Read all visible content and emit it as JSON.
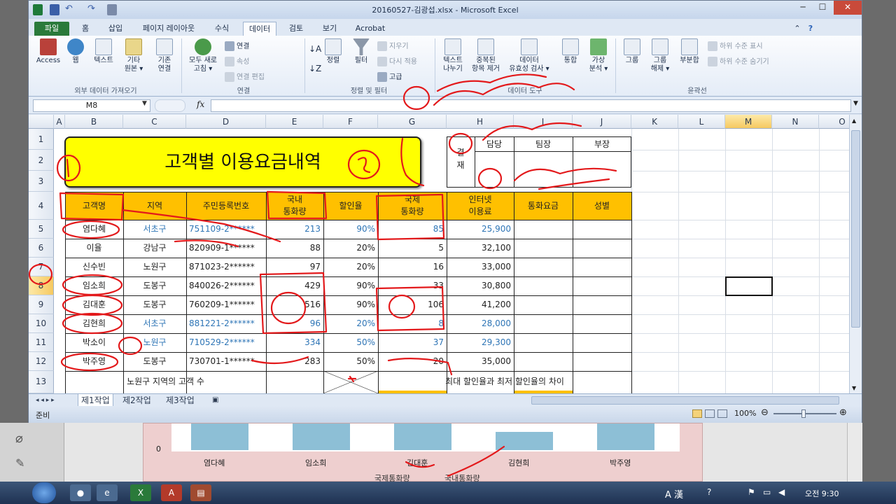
{
  "window": {
    "title": "20160527-김광섭.xlsx - Microsoft Excel",
    "minimize": "─",
    "maximize": "☐",
    "close": "✕"
  },
  "tabs": [
    "파일",
    "홈",
    "삽입",
    "페이지 레이아웃",
    "수식",
    "데이터",
    "검토",
    "보기",
    "Acrobat"
  ],
  "ribbon": {
    "external": {
      "access": "Access",
      "web": "웹",
      "text": "텍스트",
      "other1": "기타",
      "other2": "원본 ▾",
      "existing1": "기존",
      "existing2": "연결",
      "label": "외부 데이터 가져오기"
    },
    "connections": {
      "refresh1": "모두 새로",
      "refresh2": "고침 ▾",
      "connect": "연결",
      "props": "속성",
      "edit": "연결 편집",
      "label": "연결"
    },
    "sort": {
      "sort": "정렬",
      "filter": "필터",
      "clear": "지우기",
      "reapply": "다시 적용",
      "advanced": "고급",
      "label": "정렬 및 필터"
    },
    "tools": {
      "t2c1": "텍스트",
      "t2c2": "나누기",
      "dup1": "중복된",
      "dup2": "항목 제거",
      "valid1": "데이터",
      "valid2": "유효성 검사 ▾",
      "cons": "통합",
      "whatif1": "가상",
      "whatif2": "분석 ▾",
      "label": "데이터 도구"
    },
    "outline": {
      "group": "그룹",
      "ungroup1": "그룹",
      "ungroup2": "해제 ▾",
      "subtotal": "부분합",
      "show": "하위 수준 표시",
      "hide": "하위 수준 숨기기",
      "label": "윤곽선"
    }
  },
  "formula": {
    "name_box": "M8",
    "fx": "fx"
  },
  "columns": [
    "A",
    "B",
    "C",
    "D",
    "E",
    "F",
    "G",
    "H",
    "I",
    "J",
    "K",
    "L",
    "M",
    "N",
    "O"
  ],
  "rows": [
    "1",
    "2",
    "3",
    "4",
    "5",
    "6",
    "7",
    "8",
    "9",
    "10",
    "11",
    "12",
    "13"
  ],
  "sheet": {
    "title": "고객별 이용요금내역",
    "approval": {
      "label1": "결",
      "label2": "재",
      "h1": "담당",
      "h2": "팀장",
      "h3": "부장"
    },
    "headers": {
      "name": "고객명",
      "region": "지역",
      "id": "주민등록번호",
      "dom1": "국내",
      "dom2": "통화량",
      "rate": "할인율",
      "intl1": "국제",
      "intl2": "통화량",
      "net1": "인터넷",
      "net2": "이용료",
      "fee": "통화요금",
      "gender": "성별"
    },
    "data": [
      {
        "name": "염다혜",
        "region": "서초구",
        "id": "751109-2******",
        "dom": "213",
        "rate": "90%",
        "intl": "85",
        "net": "25,900",
        "blue": true
      },
      {
        "name": "이율",
        "region": "강남구",
        "id": "820909-1******",
        "dom": "88",
        "rate": "20%",
        "intl": "5",
        "net": "32,100",
        "blue": false
      },
      {
        "name": "신수빈",
        "region": "노원구",
        "id": "871023-2******",
        "dom": "97",
        "rate": "20%",
        "intl": "16",
        "net": "33,000",
        "blue": false
      },
      {
        "name": "임소희",
        "region": "도봉구",
        "id": "840026-2******",
        "dom": "429",
        "rate": "90%",
        "intl": "33",
        "net": "30,800",
        "blue": false
      },
      {
        "name": "김대훈",
        "region": "도봉구",
        "id": "760209-1******",
        "dom": "516",
        "rate": "90%",
        "intl": "106",
        "net": "41,200",
        "blue": false
      },
      {
        "name": "김현희",
        "region": "서초구",
        "id": "881221-2******",
        "dom": "96",
        "rate": "20%",
        "intl": "8",
        "net": "28,000",
        "blue": true
      },
      {
        "name": "박소이",
        "region": "노원구",
        "id": "710529-2******",
        "dom": "334",
        "rate": "50%",
        "intl": "37",
        "net": "29,300",
        "blue": true
      },
      {
        "name": "박주영",
        "region": "도봉구",
        "id": "730701-1******",
        "dom": "283",
        "rate": "50%",
        "intl": "20",
        "net": "35,000",
        "blue": false
      }
    ],
    "row13_left": "노원구 지역의 고객 수",
    "row13_right": "최대 할인율과 최저 할인율의 차이"
  },
  "sheet_tabs": [
    "제1작업",
    "제2작업",
    "제3작업"
  ],
  "status": {
    "ready": "준비",
    "zoom": "100%"
  },
  "chart_strip": {
    "zero": "0",
    "names": [
      "염다혜",
      "임소희",
      "김대훈",
      "김현희",
      "박주영"
    ],
    "legend1": "국제통화량",
    "legend2": "국내통화량"
  },
  "taskbar": {
    "time": "오전 9:30",
    "ime": "A 漢"
  }
}
